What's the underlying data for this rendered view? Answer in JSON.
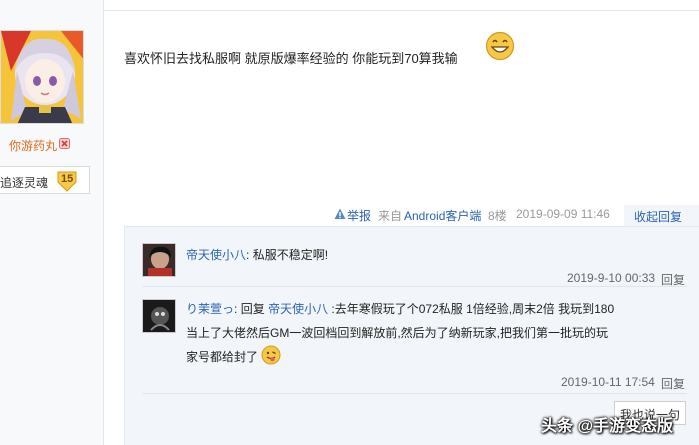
{
  "user": {
    "name": "你游药丸",
    "rank_label": "追逐灵魂",
    "rank_level": "15"
  },
  "post": {
    "text": "喜欢怀旧去找私服啊 就原版爆率经验的 你能玩到70算我输",
    "report_label": "举报",
    "from_prefix": "来自",
    "from_app": "Android客户端",
    "floor": "8楼",
    "time": "2019-09-09 11:46",
    "collapse_label": "收起回复"
  },
  "replies": [
    {
      "user": "帝天使小八",
      "colon": ":",
      "text": "私服不稳定啊!",
      "time": "2019-9-10 00:33",
      "reply_label": "回复"
    },
    {
      "user": "り茉萱っ",
      "colon": ":",
      "reply_word": "回复",
      "reply_to": "帝天使小八",
      "text_line1": ":去年寒假玩了个072私服 1倍经验,周末2倍 我玩到180",
      "text_line2": "当上了大佬然后GM一波回档回到解放前,然后为了纳新玩家,把我们第一批玩的玩",
      "text_line3": "家号都给封了",
      "time": "2019-10-11 17:54",
      "reply_label": "回复"
    }
  ],
  "say_button": "我也说一句",
  "watermark": "头条 @手游变态版",
  "colors": {
    "link": "#2b63b3",
    "username_orange": "#e06b1b",
    "panel_bg": "#f2f6fa"
  }
}
